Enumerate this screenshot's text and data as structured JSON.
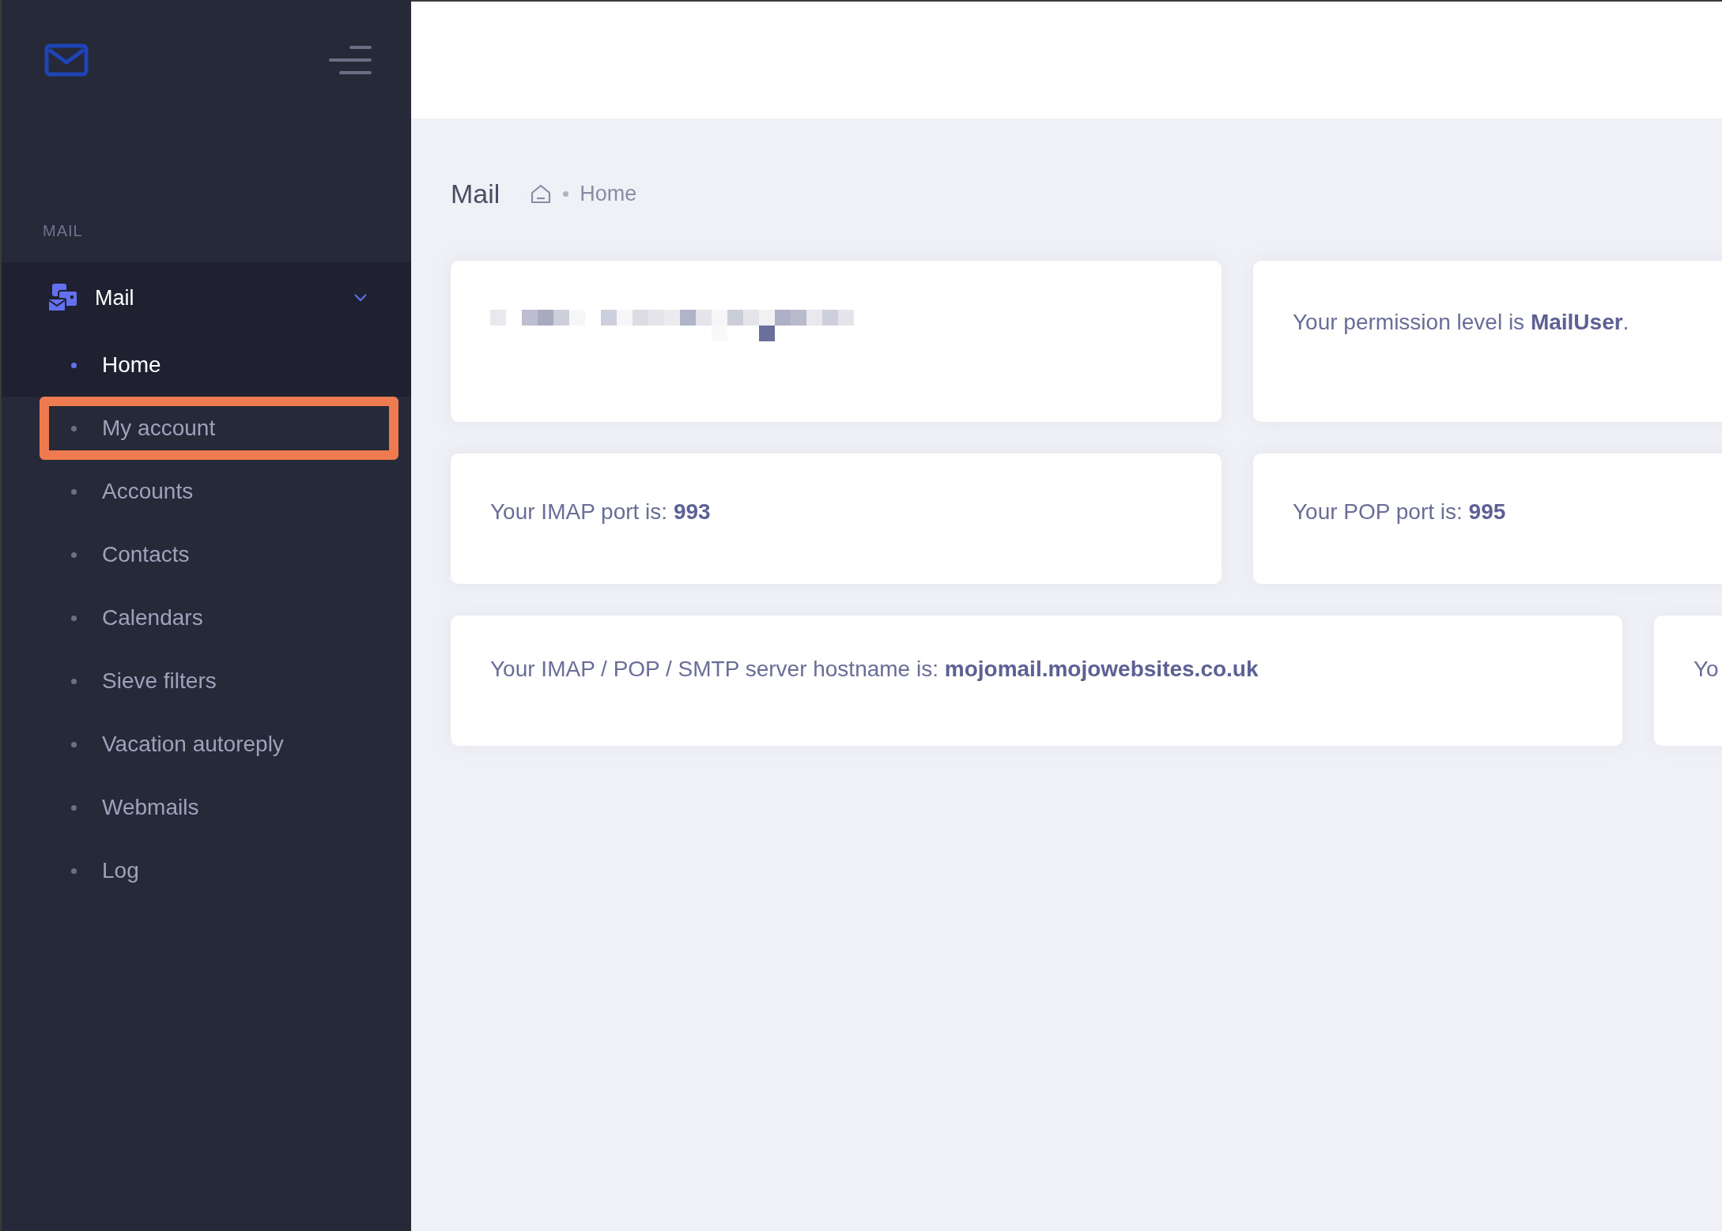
{
  "sidebar": {
    "section_label": "MAIL",
    "group": {
      "label": "Mail",
      "expanded": true,
      "items": [
        {
          "label": "Home",
          "selected": true,
          "highlighted": false
        },
        {
          "label": "My account",
          "selected": false,
          "highlighted": true
        },
        {
          "label": "Accounts",
          "selected": false,
          "highlighted": false
        },
        {
          "label": "Contacts",
          "selected": false,
          "highlighted": false
        },
        {
          "label": "Calendars",
          "selected": false,
          "highlighted": false
        },
        {
          "label": "Sieve filters",
          "selected": false,
          "highlighted": false
        },
        {
          "label": "Vacation autoreply",
          "selected": false,
          "highlighted": false
        },
        {
          "label": "Webmails",
          "selected": false,
          "highlighted": false
        },
        {
          "label": "Log",
          "selected": false,
          "highlighted": false
        }
      ]
    }
  },
  "page": {
    "title": "Mail",
    "breadcrumb": [
      "Home"
    ]
  },
  "cards": [
    [
      {
        "kind": "redacted"
      },
      {
        "kind": "text",
        "text": "Your permission level is **MailUser**."
      }
    ],
    [
      {
        "kind": "text",
        "text": "Your IMAP port is: **993**"
      },
      {
        "kind": "text",
        "text": "Your POP port is: **995**"
      }
    ],
    [
      {
        "kind": "text",
        "text": "Your IMAP / POP / SMTP server hostname is: **mojomail.mojowebsites.co.uk**"
      },
      {
        "kind": "text",
        "text": "Yo"
      }
    ]
  ]
}
